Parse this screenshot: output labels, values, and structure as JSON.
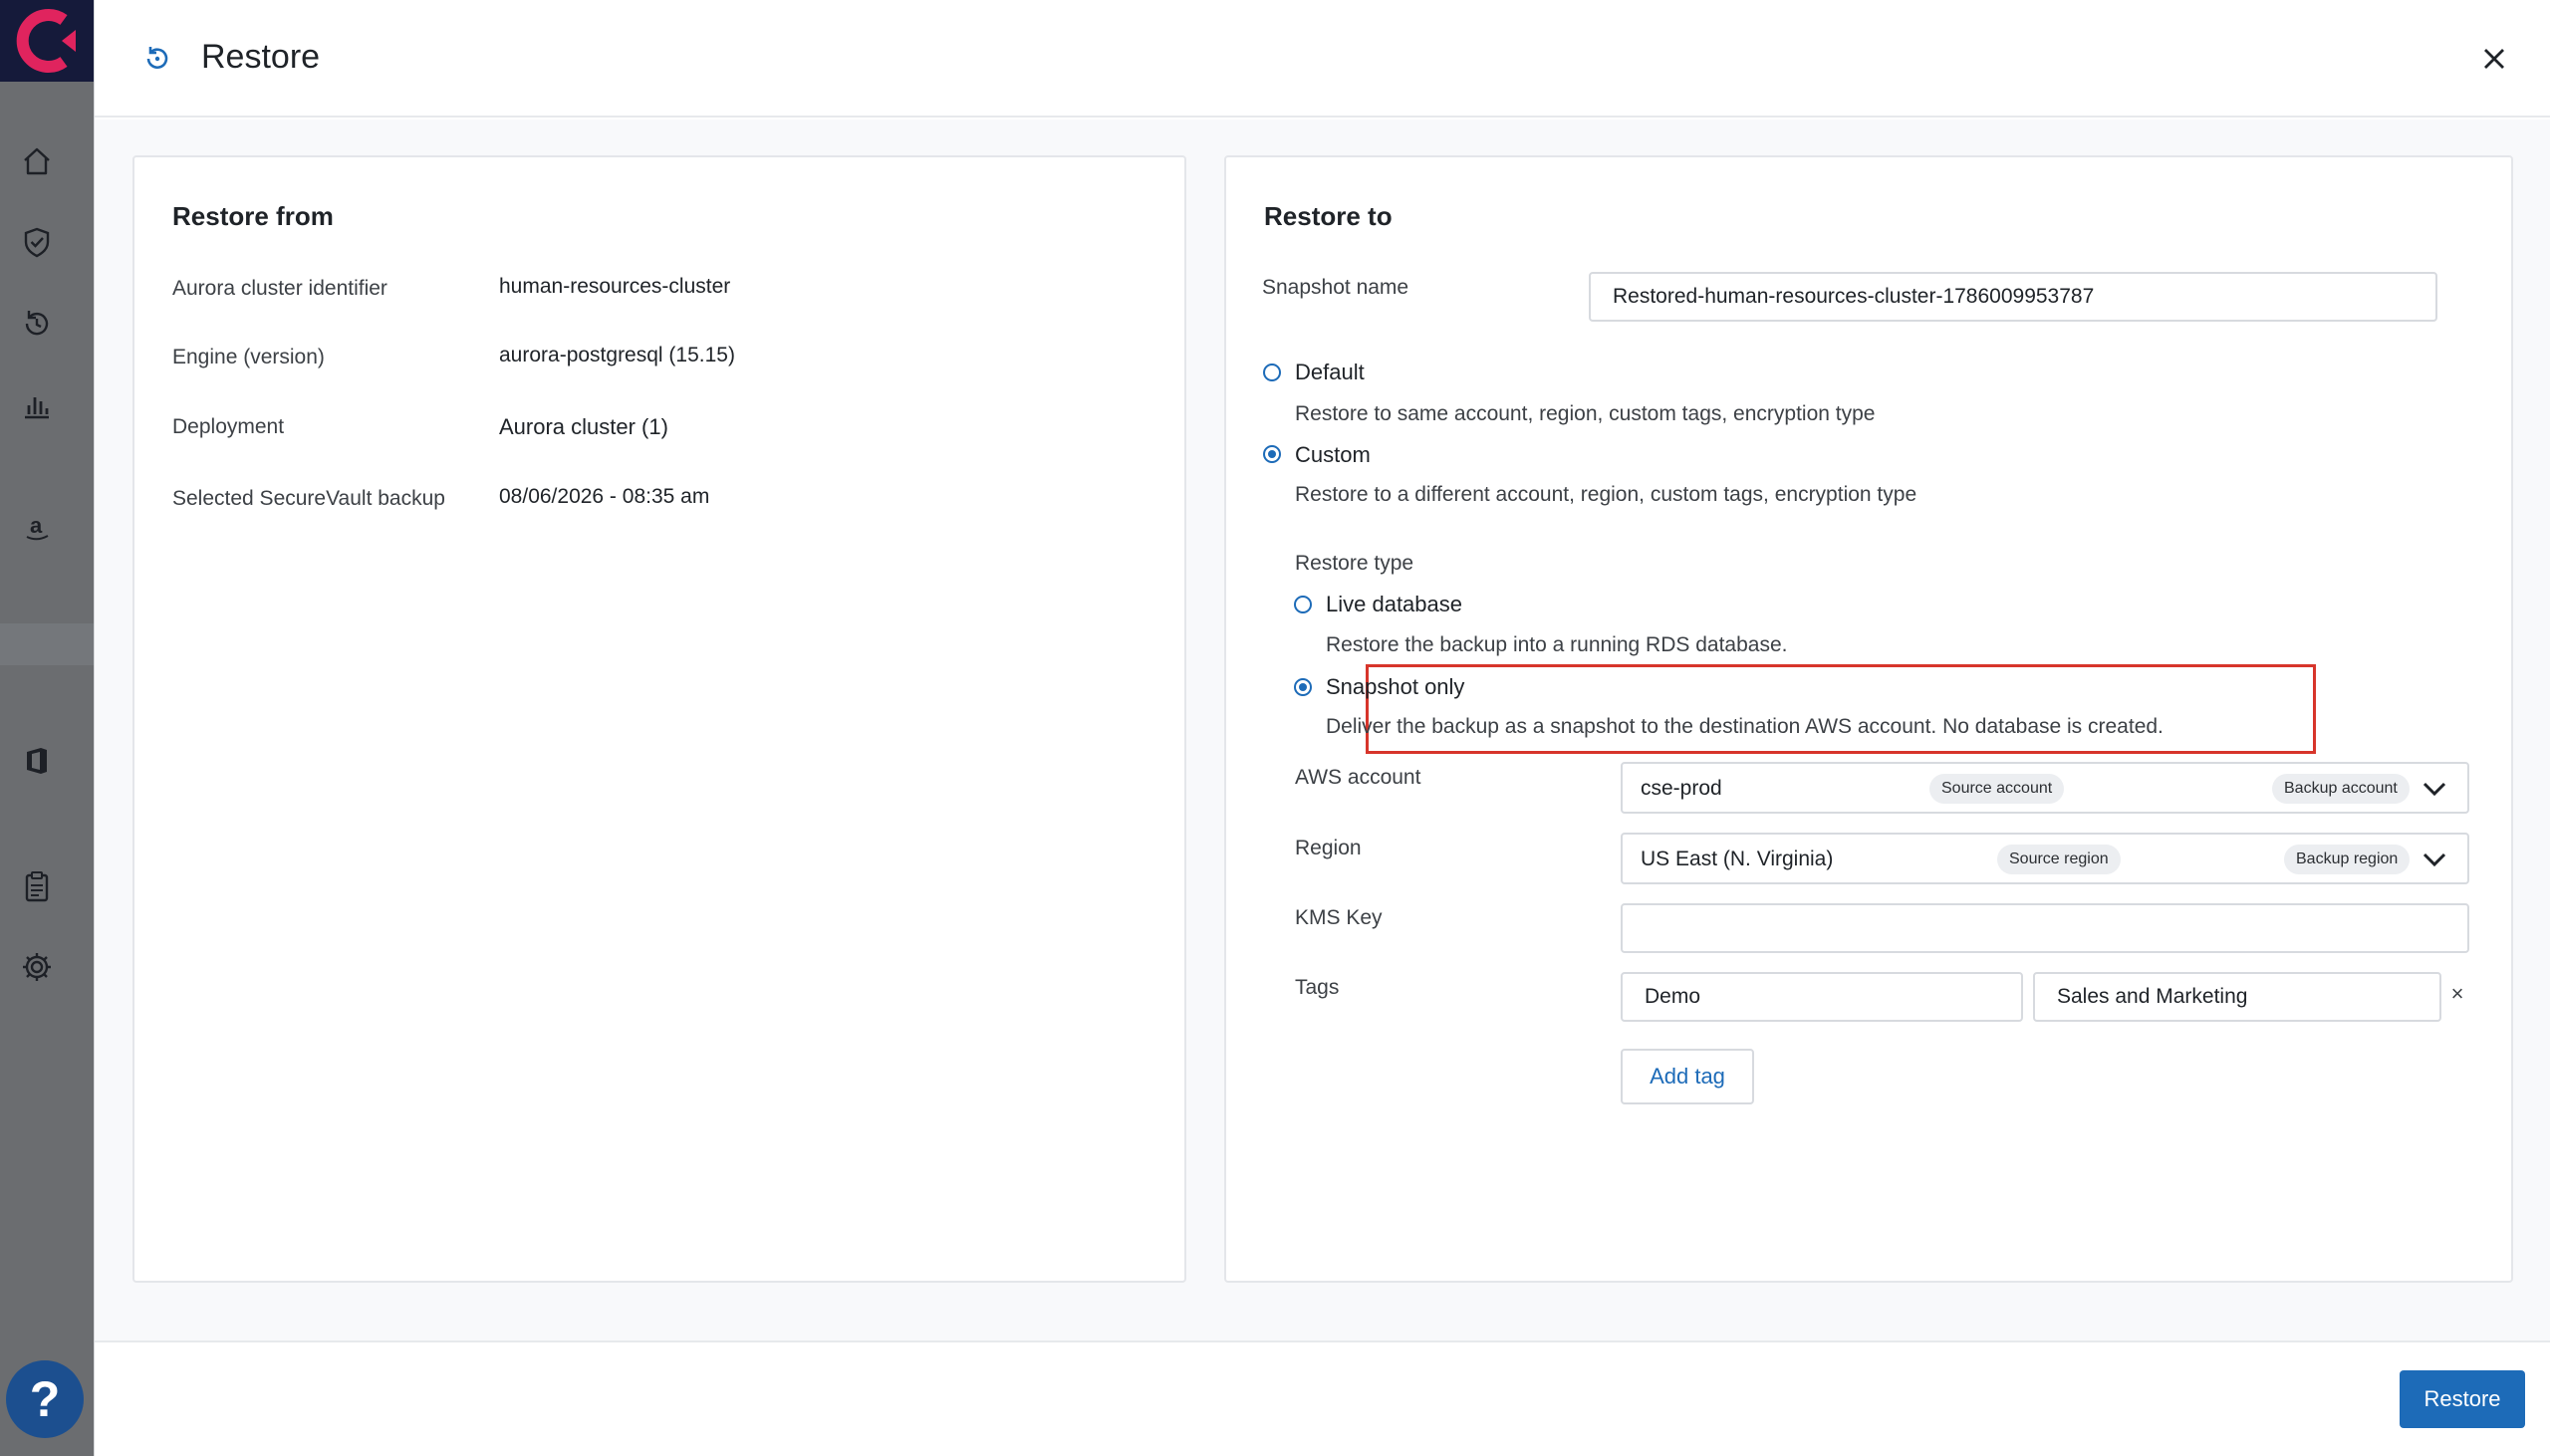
{
  "modal": {
    "title": "Restore",
    "close_icon": "close-icon",
    "restore_icon": "restore-icon"
  },
  "sidebar": {
    "items": [
      {
        "icon": "home-icon"
      },
      {
        "icon": "shield-check-icon"
      },
      {
        "icon": "restore-history-icon"
      },
      {
        "icon": "bar-chart-icon"
      },
      {
        "icon": "amazon-icon"
      },
      {
        "icon": "office-icon"
      },
      {
        "icon": "clipboard-icon"
      },
      {
        "icon": "gear-icon"
      }
    ],
    "help_label": "?"
  },
  "restore_from": {
    "title": "Restore from",
    "rows": [
      {
        "label": "Aurora cluster identifier",
        "value": "human-resources-cluster"
      },
      {
        "label": "Engine (version)",
        "value": "aurora-postgresql (15.15)"
      },
      {
        "label": "Deployment",
        "value": "Aurora cluster (1)"
      },
      {
        "label": "Selected SecureVault backup",
        "value": "08/06/2026 - 08:35 am"
      }
    ]
  },
  "restore_to": {
    "title": "Restore to",
    "snapshot_name_label": "Snapshot name",
    "snapshot_name_value": "Restored-human-resources-cluster-1786009953787",
    "mode_options": [
      {
        "label": "Default",
        "description": "Restore to same account, region, custom tags, encryption type",
        "checked": false
      },
      {
        "label": "Custom",
        "description": "Restore to a different account, region, custom tags, encryption type",
        "checked": true
      }
    ],
    "restore_type_label": "Restore type",
    "restore_type_options": [
      {
        "label": "Live database",
        "description": "Restore the backup into a running RDS database.",
        "checked": false
      },
      {
        "label": "Snapshot only",
        "description": "Deliver the backup as a snapshot to the destination AWS account. No database is created.",
        "checked": true
      }
    ],
    "aws_account": {
      "label": "AWS account",
      "value": "cse-prod",
      "badge_source": "Source account",
      "badge_backup": "Backup account"
    },
    "region": {
      "label": "Region",
      "value": "US East (N. Virginia)",
      "badge_source": "Source region",
      "badge_backup": "Backup region"
    },
    "kms_key": {
      "label": "KMS Key",
      "value": ""
    },
    "tags": {
      "label": "Tags",
      "key": "Demo",
      "value": "Sales and Marketing",
      "remove_symbol": "×",
      "add_label": "Add tag"
    }
  },
  "footer": {
    "restore_button": "Restore"
  },
  "colors": {
    "accent": "#1d6bb8",
    "highlight": "#d7352b",
    "sidebar": "#6b6d70",
    "logo_bg": "#151a3a"
  }
}
